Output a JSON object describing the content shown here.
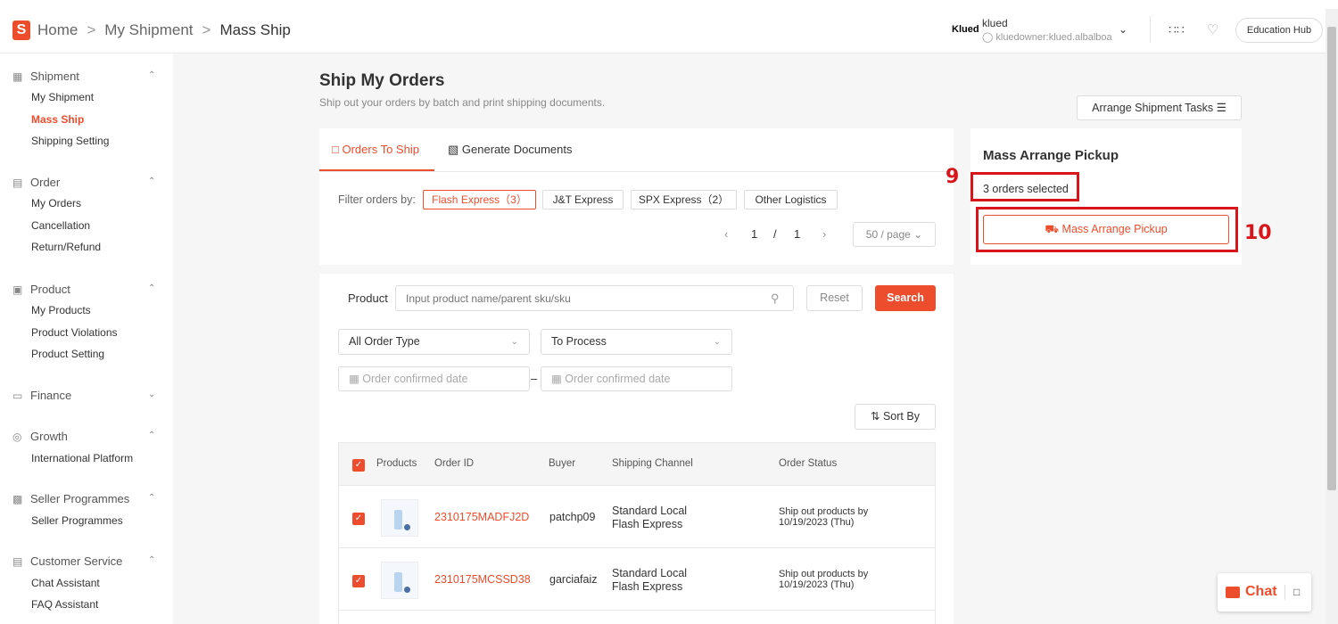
{
  "topbar": {
    "logo_letter": "S",
    "breadcrumb": [
      "Home",
      "My Shipment",
      "Mass Ship"
    ],
    "breadcrumb_sep": ">",
    "shop_brand": "Klued",
    "shop_name": "klued",
    "shop_user": "kluedowner:klued.albalboa",
    "education_hub": "Education Hub"
  },
  "sidebar": {
    "groups": [
      {
        "title": "Shipment",
        "icon": "shipment-icon",
        "items": [
          "My Shipment",
          "Mass Ship",
          "Shipping Setting"
        ],
        "active": "Mass Ship"
      },
      {
        "title": "Order",
        "icon": "order-icon",
        "items": [
          "My Orders",
          "Cancellation",
          "Return/Refund"
        ]
      },
      {
        "title": "Product",
        "icon": "product-icon",
        "items": [
          "My Products",
          "Product Violations",
          "Product Setting"
        ]
      },
      {
        "title": "Finance",
        "icon": "finance-icon",
        "items": []
      },
      {
        "title": "Growth",
        "icon": "growth-icon",
        "items": [
          "International Platform"
        ]
      },
      {
        "title": "Seller Programmes",
        "icon": "seller-programmes-icon",
        "items": [
          "Seller Programmes"
        ]
      },
      {
        "title": "Customer Service",
        "icon": "customer-service-icon",
        "items": [
          "Chat Assistant",
          "FAQ Assistant"
        ]
      }
    ]
  },
  "main": {
    "title": "Ship My Orders",
    "subtitle": "Ship out your orders by batch and print shipping documents.",
    "arrange_tasks": "Arrange Shipment Tasks",
    "tabs": [
      "Orders To Ship",
      "Generate Documents"
    ],
    "filter_label": "Filter orders by:",
    "filters": [
      "Flash Express（3）",
      "J&T Express",
      "SPX Express（2）",
      "Other Logistics"
    ],
    "pager": {
      "current": "1",
      "sep": "/",
      "total": "1",
      "per_page": "50 / page"
    },
    "product_label": "Product",
    "product_placeholder": "Input product name/parent sku/sku",
    "reset": "Reset",
    "search": "Search",
    "order_type": "All Order Type",
    "process": "To Process",
    "date_placeholder": "Order confirmed date",
    "date_sep": "–",
    "sort_by": "Sort By",
    "columns": [
      "Products",
      "Order ID",
      "Buyer",
      "Shipping Channel",
      "Order Status"
    ],
    "rows": [
      {
        "order_id": "2310175MADFJ2D",
        "buyer": "patchp09",
        "channel_1": "Standard Local",
        "channel_2": "Flash Express",
        "status_1": "Ship out products by",
        "status_2": "10/19/2023 (Thu)"
      },
      {
        "order_id": "2310175MCSSD38",
        "buyer": "garciafaiz",
        "channel_1": "Standard Local",
        "channel_2": "Flash Express",
        "status_1": "Ship out products by",
        "status_2": "10/19/2023 (Thu)"
      }
    ]
  },
  "right_panel": {
    "title": "Mass Arrange Pickup",
    "selected": "3 orders selected",
    "button": "Mass Arrange Pickup"
  },
  "annotations": {
    "step_9": "9",
    "step_10": "10",
    "color": "#d8151b"
  },
  "chat": {
    "label": "Chat"
  },
  "colors": {
    "accent": "#ee4d2d"
  }
}
